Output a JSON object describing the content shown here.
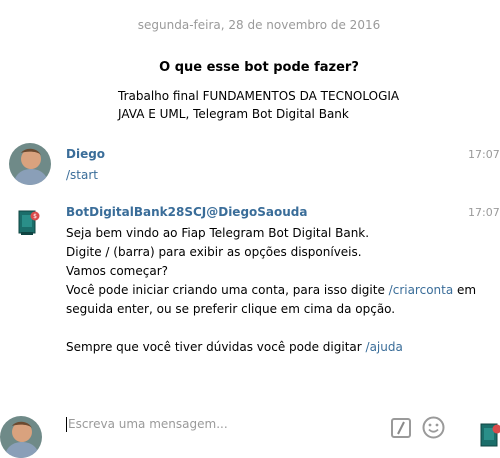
{
  "chat": {
    "date_separator": "segunda-feira, 28 de novembro de 2016",
    "bot_intro": {
      "title": "O que esse bot pode fazer?",
      "line1": "Trabalho final FUNDAMENTOS DA TECNOLOGIA",
      "line2": "JAVA E UML, Telegram Bot Digital Bank"
    },
    "messages": [
      {
        "author": "Diego",
        "time": "17:07:",
        "text": "/start"
      },
      {
        "author": "BotDigitalBank28SCJ@DiegoSaouda",
        "time": "17:07:",
        "line1": "Seja bem vindo ao Fiap Telegram Bot Digital Bank.",
        "line2": "Digite / (barra) para exibir as opções disponíveis.",
        "line3": "Vamos começar?",
        "line4_pre": "Você pode iniciar criando uma conta, para isso digite ",
        "line4_cmd": "/criarconta",
        "line4_post": " em",
        "line5": "seguida enter, ou se preferir clique em cima da opção.",
        "line6_pre": "Sempre que você tiver dúvidas você pode digitar ",
        "line6_cmd": "/ajuda"
      }
    ]
  },
  "composer": {
    "placeholder": "Escreva uma mensagem...",
    "command_icon": "slash-command-icon",
    "emoji_icon": "smiley-icon"
  },
  "colors": {
    "author_link": "#3a6d99",
    "muted": "#9a9a9a",
    "bot_green": "#1b6e6a"
  }
}
